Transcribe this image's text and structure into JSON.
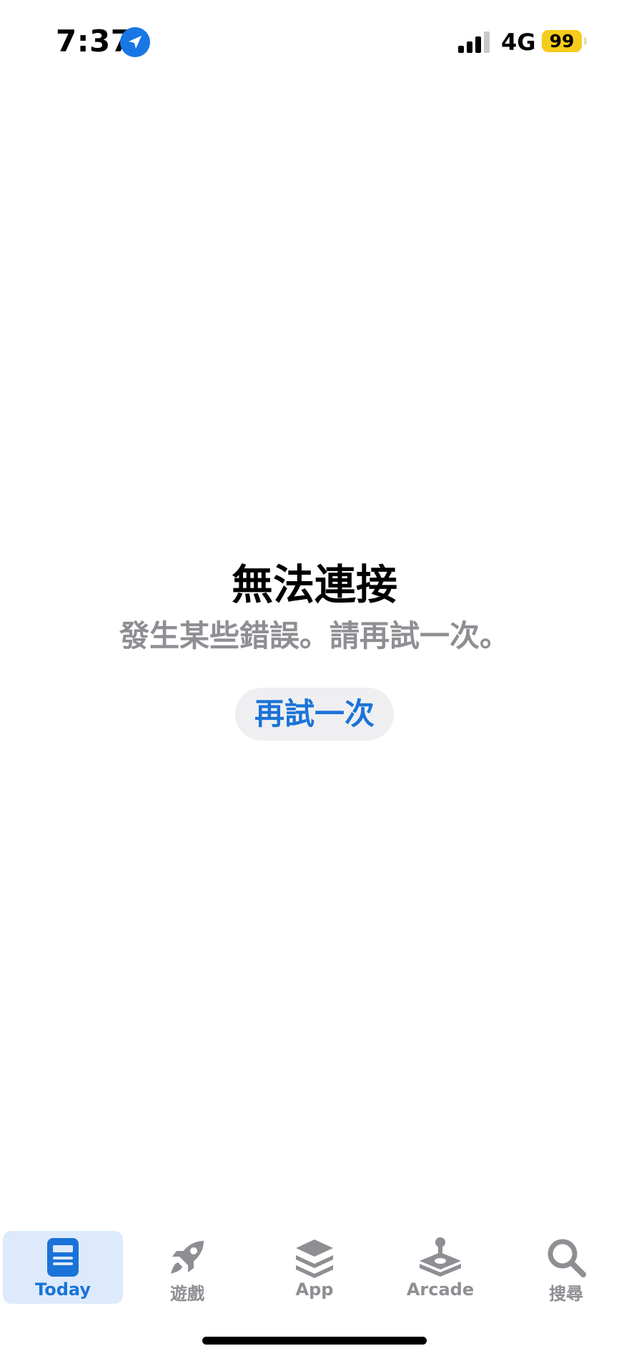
{
  "status_bar": {
    "time": "7:37",
    "network": "4G",
    "battery": "99",
    "location_icon": "location-arrow-icon",
    "signal_icon": "cellular-signal-icon"
  },
  "error": {
    "title": "無法連接",
    "message": "發生某些錯誤。請再試一次。",
    "retry_label": "再試一次"
  },
  "tabs": [
    {
      "label": "Today",
      "icon": "today-icon",
      "active": true
    },
    {
      "label": "遊戲",
      "icon": "rocket-icon",
      "active": false
    },
    {
      "label": "App",
      "icon": "layers-icon",
      "active": false
    },
    {
      "label": "Arcade",
      "icon": "joystick-icon",
      "active": false
    },
    {
      "label": "搜尋",
      "icon": "search-icon",
      "active": false
    }
  ],
  "colors": {
    "accent": "#1a73d8",
    "inactive": "#8e8e93",
    "battery": "#f5cc1b",
    "active_tab_bg": "#ddeafc"
  }
}
